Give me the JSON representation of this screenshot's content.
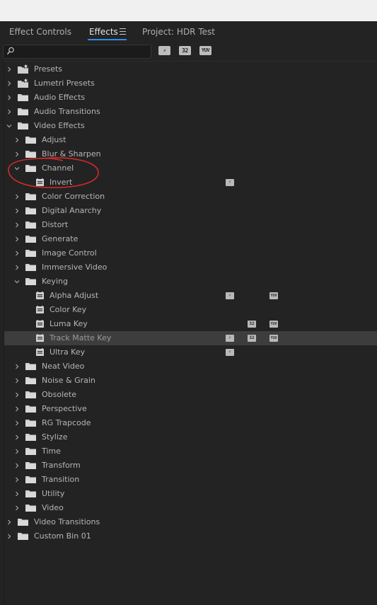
{
  "tabs": {
    "effect_controls": "Effect Controls",
    "effects": "Effects",
    "project": "Project: HDR Test"
  },
  "search": {
    "value": "",
    "placeholder": ""
  },
  "filter_buttons": [
    {
      "name": "accelerated",
      "label": "⚡"
    },
    {
      "name": "32bit",
      "label": "32"
    },
    {
      "name": "yuv",
      "label": "YUV"
    }
  ],
  "tree": [
    {
      "label": "Presets",
      "kind": "preset-folder",
      "depth": 0,
      "expanded": false
    },
    {
      "label": "Lumetri Presets",
      "kind": "preset-folder",
      "depth": 0,
      "expanded": false
    },
    {
      "label": "Audio Effects",
      "kind": "folder",
      "depth": 0,
      "expanded": false
    },
    {
      "label": "Audio Transitions",
      "kind": "folder",
      "depth": 0,
      "expanded": false
    },
    {
      "label": "Video Effects",
      "kind": "folder",
      "depth": 0,
      "expanded": true
    },
    {
      "label": "Adjust",
      "kind": "folder",
      "depth": 1,
      "expanded": false
    },
    {
      "label": "Blur & Sharpen",
      "kind": "folder",
      "depth": 1,
      "expanded": false
    },
    {
      "label": "Channel",
      "kind": "folder",
      "depth": 1,
      "expanded": true
    },
    {
      "label": "Invert",
      "kind": "effect",
      "depth": 2,
      "badges": [
        "accel"
      ]
    },
    {
      "label": "Color Correction",
      "kind": "folder",
      "depth": 1,
      "expanded": false
    },
    {
      "label": "Digital Anarchy",
      "kind": "folder",
      "depth": 1,
      "expanded": false
    },
    {
      "label": "Distort",
      "kind": "folder",
      "depth": 1,
      "expanded": false
    },
    {
      "label": "Generate",
      "kind": "folder",
      "depth": 1,
      "expanded": false
    },
    {
      "label": "Image Control",
      "kind": "folder",
      "depth": 1,
      "expanded": false
    },
    {
      "label": "Immersive Video",
      "kind": "folder",
      "depth": 1,
      "expanded": false
    },
    {
      "label": "Keying",
      "kind": "folder",
      "depth": 1,
      "expanded": true
    },
    {
      "label": "Alpha Adjust",
      "kind": "effect",
      "depth": 2,
      "badges": [
        "accel",
        "yuv"
      ]
    },
    {
      "label": "Color Key",
      "kind": "effect",
      "depth": 2,
      "badges": []
    },
    {
      "label": "Luma Key",
      "kind": "effect",
      "depth": 2,
      "badges": [
        "32",
        "yuv"
      ]
    },
    {
      "label": "Track Matte Key",
      "kind": "effect",
      "depth": 2,
      "badges": [
        "accel",
        "32",
        "yuv"
      ],
      "selected": true
    },
    {
      "label": "Ultra Key",
      "kind": "effect",
      "depth": 2,
      "badges": [
        "accel"
      ]
    },
    {
      "label": "Neat Video",
      "kind": "folder",
      "depth": 1,
      "expanded": false
    },
    {
      "label": "Noise & Grain",
      "kind": "folder",
      "depth": 1,
      "expanded": false
    },
    {
      "label": "Obsolete",
      "kind": "folder",
      "depth": 1,
      "expanded": false
    },
    {
      "label": "Perspective",
      "kind": "folder",
      "depth": 1,
      "expanded": false
    },
    {
      "label": "RG Trapcode",
      "kind": "folder",
      "depth": 1,
      "expanded": false
    },
    {
      "label": "Stylize",
      "kind": "folder",
      "depth": 1,
      "expanded": false
    },
    {
      "label": "Time",
      "kind": "folder",
      "depth": 1,
      "expanded": false
    },
    {
      "label": "Transform",
      "kind": "folder",
      "depth": 1,
      "expanded": false
    },
    {
      "label": "Transition",
      "kind": "folder",
      "depth": 1,
      "expanded": false
    },
    {
      "label": "Utility",
      "kind": "folder",
      "depth": 1,
      "expanded": false
    },
    {
      "label": "Video",
      "kind": "folder",
      "depth": 1,
      "expanded": false
    },
    {
      "label": "Video Transitions",
      "kind": "folder",
      "depth": 0,
      "expanded": false
    },
    {
      "label": "Custom Bin 01",
      "kind": "folder",
      "depth": 0,
      "expanded": false
    }
  ],
  "badge_text": {
    "accel": "⚡",
    "32": "32",
    "yuv": "YUV"
  },
  "colors": {
    "accent": "#2d8ceb",
    "annotation": "#d42a2a",
    "background": "#232323"
  }
}
